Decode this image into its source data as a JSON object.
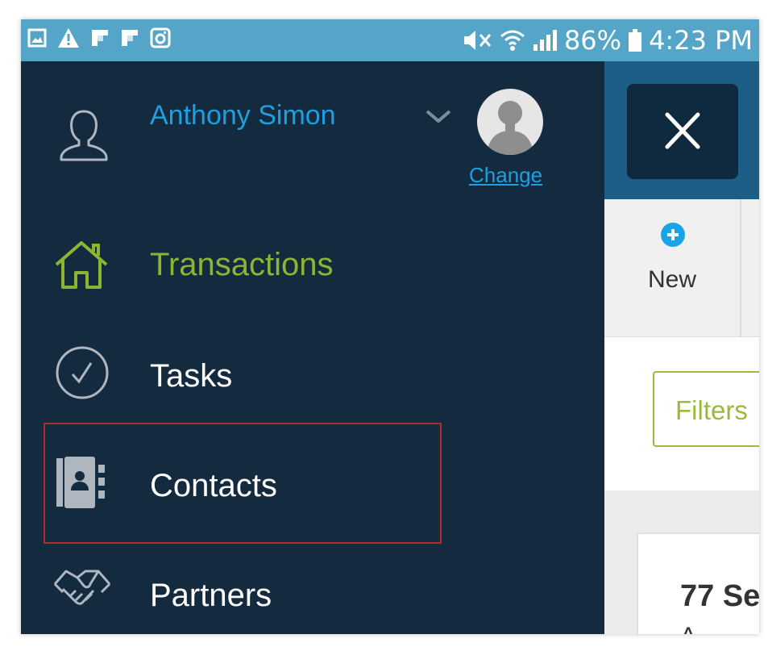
{
  "status_bar": {
    "notification_icons": [
      "gallery-icon",
      "warning-icon",
      "flipboard-icon",
      "flipboard-icon",
      "instagram-icon"
    ],
    "battery_percent": "86%",
    "time": "4:23 PM"
  },
  "drawer": {
    "user_name": "Anthony Simon",
    "change_label": "Change",
    "nav_items": [
      {
        "label": "Transactions",
        "icon": "home-icon",
        "color": "#8db433",
        "active": true
      },
      {
        "label": "Tasks",
        "icon": "check-circle-icon",
        "color": "#ffffff"
      },
      {
        "label": "Contacts",
        "icon": "contacts-book-icon",
        "color": "#ffffff",
        "highlighted": true
      },
      {
        "label": "Partners",
        "icon": "handshake-icon",
        "color": "#ffffff"
      }
    ]
  },
  "background_app": {
    "new_label": "New",
    "filters_label": "Filters",
    "card_title": "77 Se",
    "card_subtitle": "A"
  },
  "colors": {
    "status_bar": "#54a5c7",
    "drawer_bg": "#132a3f",
    "accent_blue": "#1e9fe0",
    "accent_green": "#8db433",
    "highlight_red": "#b22b2b"
  }
}
